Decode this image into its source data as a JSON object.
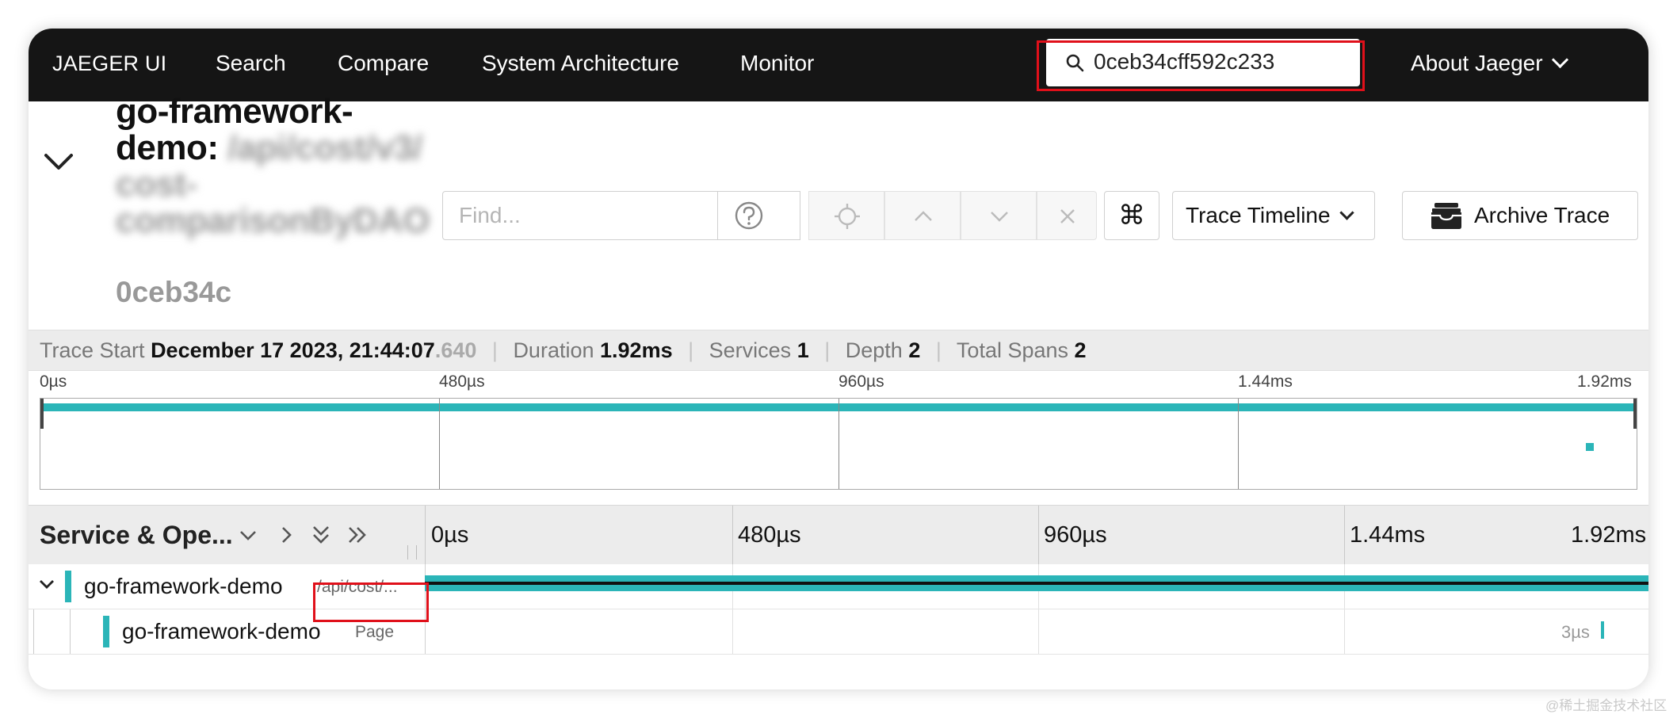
{
  "nav": {
    "brand": "JAEGER UI",
    "items": [
      "Search",
      "Compare",
      "System Architecture",
      "Monitor"
    ],
    "search_value": "0ceb34cff592c233",
    "about": "About Jaeger"
  },
  "trace": {
    "title_line1": "go-framework-",
    "title_line2a": "demo: ",
    "title_line2b": "/api/cost/v3/",
    "title_line3": "cost-",
    "title_line4": "comparisonByDAO",
    "trace_id": "0ceb34c",
    "find_placeholder": "Find...",
    "view_label": "Trace Timeline",
    "archive_label": "Archive Trace",
    "cmd_glyph": "⌘"
  },
  "summary": {
    "start_label": "Trace Start",
    "start_value": "December 17 2023, 21:44:07",
    "start_ms": ".640",
    "duration_label": "Duration",
    "duration_value": "1.92ms",
    "services_label": "Services",
    "services_value": "1",
    "depth_label": "Depth",
    "depth_value": "2",
    "spans_label": "Total Spans",
    "spans_value": "2"
  },
  "minimap_ticks": [
    "0µs",
    "480µs",
    "960µs",
    "1.44ms",
    "1.92ms"
  ],
  "table": {
    "header_title": "Service & Ope...",
    "timeline_ticks": [
      "0µs",
      "480µs",
      "960µs",
      "1.44ms",
      "1.92ms"
    ],
    "rows": [
      {
        "service": "go-framework-demo",
        "operation": "/api/cost/..."
      },
      {
        "service": "go-framework-demo",
        "operation": "Page",
        "duration": "3µs"
      }
    ]
  },
  "colors": {
    "service": "#2bb5b8",
    "nav_bg": "#151515",
    "highlight": "#e0101a"
  },
  "watermark": "@稀土掘金技术社区"
}
